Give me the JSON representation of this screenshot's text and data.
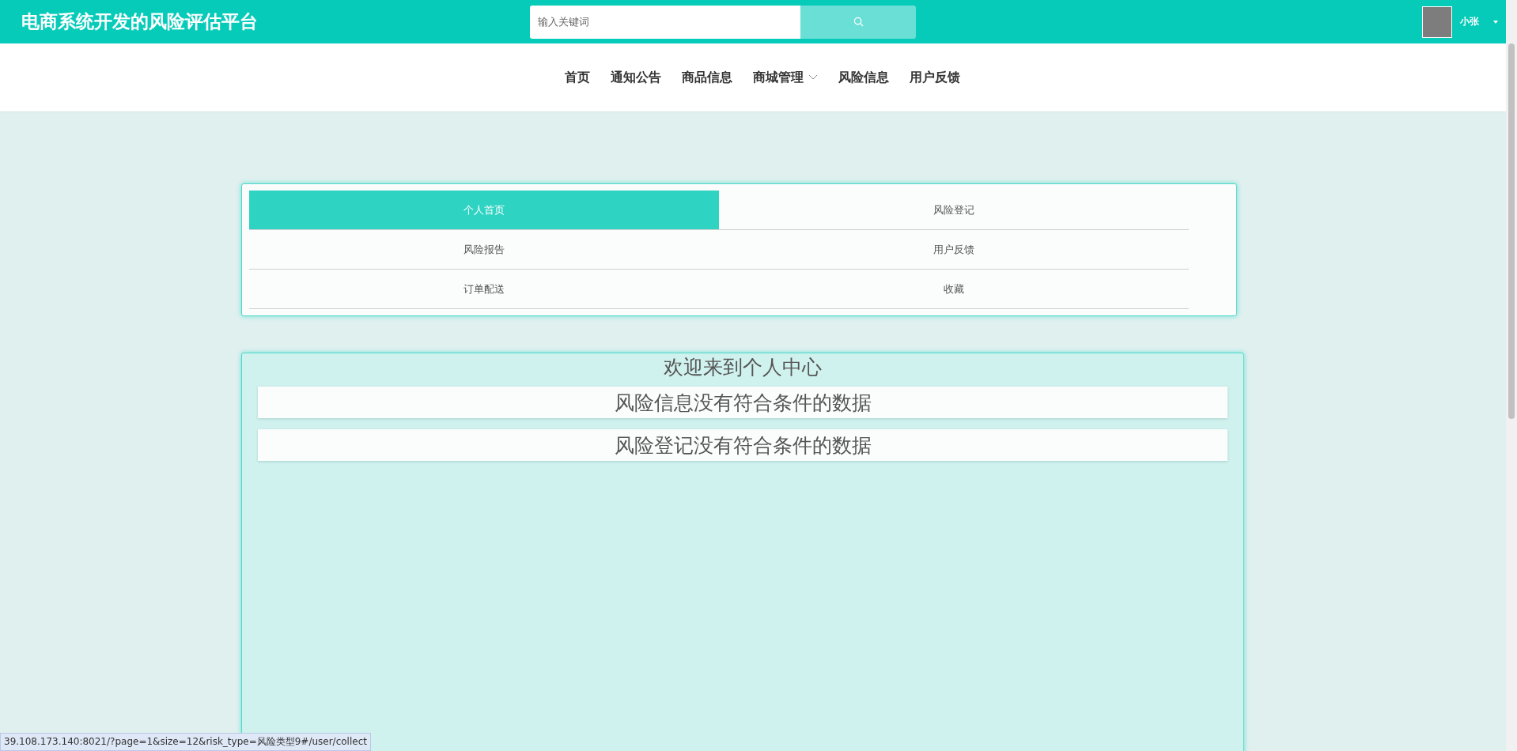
{
  "header": {
    "title": "电商系统开发的风险评估平台",
    "search": {
      "placeholder": "输入关键词"
    },
    "user": {
      "name": "小张"
    }
  },
  "nav": [
    {
      "label": "首页",
      "dropdown": false
    },
    {
      "label": "通知公告",
      "dropdown": false
    },
    {
      "label": "商品信息",
      "dropdown": false
    },
    {
      "label": "商城管理",
      "dropdown": true
    },
    {
      "label": "风险信息",
      "dropdown": false
    },
    {
      "label": "用户反馈",
      "dropdown": false
    }
  ],
  "tabs": [
    {
      "label": "个人首页",
      "selected": true
    },
    {
      "label": "风险登记",
      "selected": false
    },
    {
      "label": "风险报告",
      "selected": false
    },
    {
      "label": "用户反馈",
      "selected": false
    },
    {
      "label": "订单配送",
      "selected": false
    },
    {
      "label": "收藏",
      "selected": false
    }
  ],
  "panel": {
    "title": "欢迎来到个人中心",
    "notices": [
      "风险信息没有符合条件的数据",
      "风险登记没有符合条件的数据"
    ]
  },
  "status_bar": "39.108.173.140:8021/?page=1&size=12&risk_type=风险类型9#/user/collect"
}
